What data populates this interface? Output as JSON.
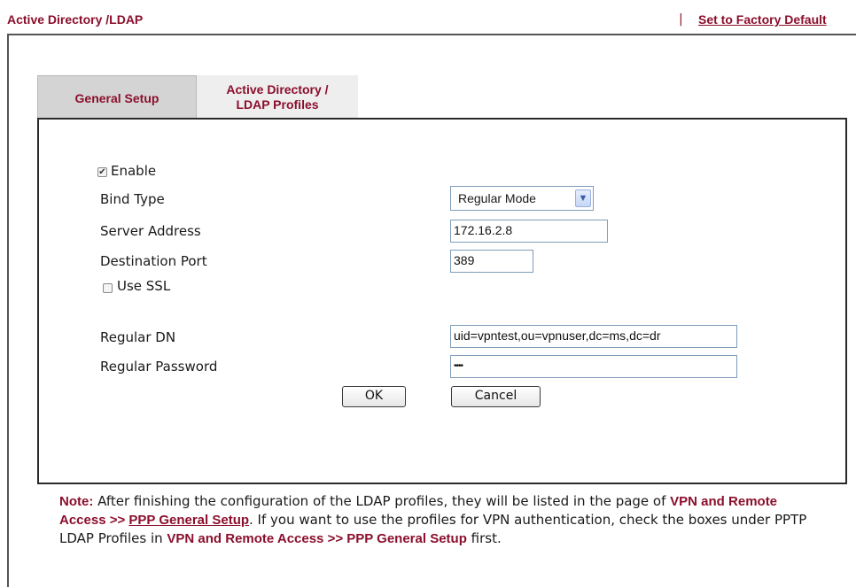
{
  "header": {
    "title": "Active Directory /LDAP",
    "separator": "|",
    "factory_default": "Set to Factory Default"
  },
  "tabs": [
    {
      "label": "General Setup",
      "active": true
    },
    {
      "label_line1": "Active Directory /",
      "label_line2": "LDAP Profiles",
      "active": false
    }
  ],
  "form": {
    "enable": {
      "label": "Enable",
      "checked": true
    },
    "bind_type": {
      "label": "Bind Type",
      "value": "Regular Mode"
    },
    "server_address": {
      "label": "Server Address",
      "value": "172.16.2.8"
    },
    "destination_port": {
      "label": "Destination Port",
      "value": "389"
    },
    "use_ssl": {
      "label": "Use SSL",
      "checked": false
    },
    "regular_dn": {
      "label": "Regular DN",
      "value": "uid=vpntest,ou=vpnuser,dc=ms,dc=dr"
    },
    "regular_password": {
      "label": "Regular Password",
      "value": "••••"
    }
  },
  "buttons": {
    "ok": "OK",
    "cancel": "Cancel"
  },
  "note": {
    "prefix": "Note:",
    "t1": " After finishing the configuration of the LDAP profiles, they will be listed in the page of ",
    "link1": "VPN and Remote Access >> ",
    "link1b": "PPP General Setup",
    "t2": ". If you want to use the profiles for VPN authentication, check the boxes under PPTP LDAP Profiles in ",
    "link2": "VPN and Remote Access >> PPP General Setup",
    "t3": " first."
  },
  "colors": {
    "accent": "#8b0f2c",
    "tab_active": "#d4d4d4",
    "tab_inactive": "#eeeeee"
  }
}
